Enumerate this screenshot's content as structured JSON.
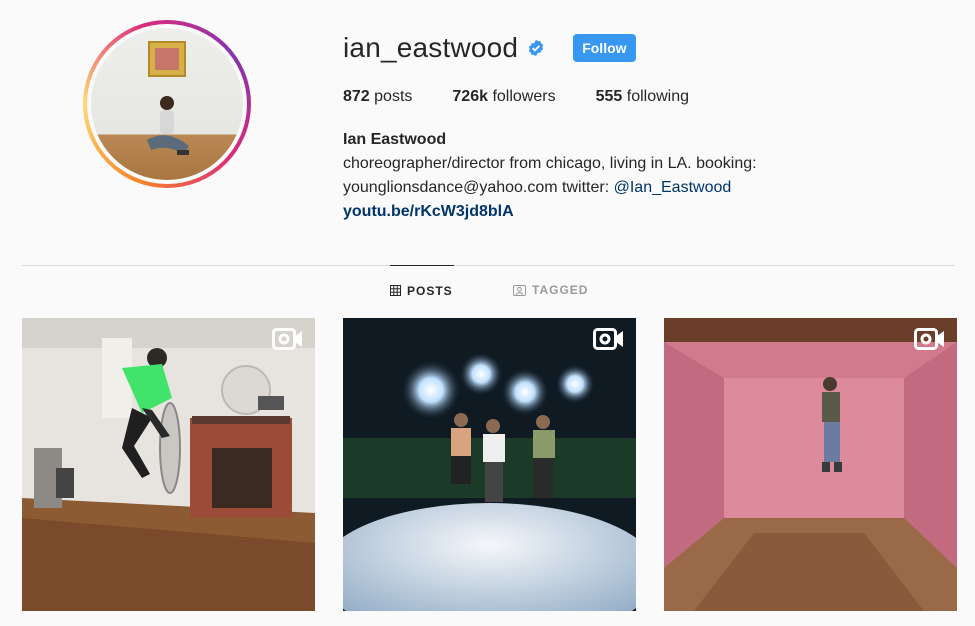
{
  "profile": {
    "username": "ian_eastwood",
    "follow_label": "Follow",
    "stats": {
      "posts_count": "872",
      "posts_label": "posts",
      "followers_count": "726k",
      "followers_label": "followers",
      "following_count": "555",
      "following_label": "following"
    },
    "bio": {
      "full_name": "Ian Eastwood",
      "line1": "choreographer/director from chicago, living in LA. booking:",
      "line2_prefix": "younglionsdance@yahoo.com twitter: ",
      "twitter_handle": "@Ian_Eastwood",
      "link": "youtu.be/rKcW3jd8blA"
    }
  },
  "tabs": {
    "posts": "POSTS",
    "tagged": "TAGGED"
  },
  "posts": [
    {
      "type": "video",
      "icon": "video-icon"
    },
    {
      "type": "video",
      "icon": "video-icon"
    },
    {
      "type": "video",
      "icon": "video-icon"
    }
  ],
  "colors": {
    "accent": "#3897f0",
    "link": "#003569",
    "verified": "#3897f0"
  }
}
